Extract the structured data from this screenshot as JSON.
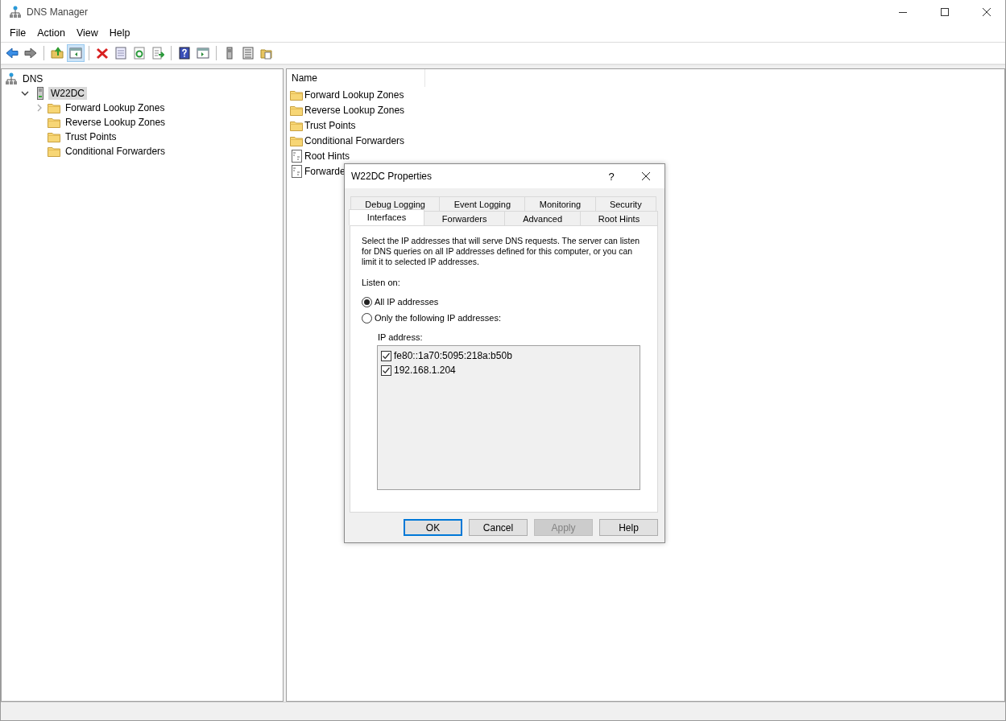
{
  "window": {
    "title": "DNS Manager"
  },
  "menu": [
    "File",
    "Action",
    "View",
    "Help"
  ],
  "toolbar": [
    {
      "kind": "back",
      "pressed": false
    },
    {
      "kind": "forward",
      "pressed": false
    },
    {
      "kind": "separator"
    },
    {
      "kind": "up",
      "pressed": false
    },
    {
      "kind": "tree",
      "pressed": true
    },
    {
      "kind": "separator"
    },
    {
      "kind": "delete",
      "pressed": false
    },
    {
      "kind": "properties",
      "pressed": false
    },
    {
      "kind": "refresh",
      "pressed": false
    },
    {
      "kind": "export",
      "pressed": false
    },
    {
      "kind": "separator"
    },
    {
      "kind": "help",
      "pressed": false
    },
    {
      "kind": "pane",
      "pressed": false
    },
    {
      "kind": "separator"
    },
    {
      "kind": "server",
      "pressed": false
    },
    {
      "kind": "list",
      "pressed": false
    },
    {
      "kind": "folder-doc",
      "pressed": false
    }
  ],
  "tree": [
    {
      "label": "DNS",
      "kind": "dns",
      "selected": false,
      "children": [
        {
          "label": "W22DC",
          "kind": "server",
          "selected": true,
          "expanded": true,
          "children": [
            {
              "label": "Forward Lookup Zones",
              "kind": "folder",
              "selected": false,
              "expanded": false
            },
            {
              "label": "Reverse Lookup Zones",
              "kind": "folder",
              "selected": false
            },
            {
              "label": "Trust Points",
              "kind": "folder",
              "selected": false
            },
            {
              "label": "Conditional Forwarders",
              "kind": "folder",
              "selected": false
            }
          ]
        }
      ]
    }
  ],
  "list": {
    "columns": [
      "Name"
    ],
    "items": [
      {
        "name": "Forward Lookup Zones",
        "kind": "folder"
      },
      {
        "name": "Reverse Lookup Zones",
        "kind": "folder"
      },
      {
        "name": "Trust Points",
        "kind": "folder"
      },
      {
        "name": "Conditional Forwarders",
        "kind": "folder"
      },
      {
        "name": "Root Hints",
        "kind": "file"
      },
      {
        "name": "Forwarde",
        "kind": "file"
      }
    ]
  },
  "dialog": {
    "title": "W22DC Properties",
    "help": "?",
    "tab_rows": [
      [
        {
          "label": "Debug Logging",
          "selected": false
        },
        {
          "label": "Event Logging",
          "selected": false
        },
        {
          "label": "Monitoring",
          "selected": false
        },
        {
          "label": "Security",
          "selected": false
        }
      ],
      [
        {
          "label": "Interfaces",
          "selected": true
        },
        {
          "label": "Forwarders",
          "selected": false
        },
        {
          "label": "Advanced",
          "selected": false
        },
        {
          "label": "Root Hints",
          "selected": false
        }
      ]
    ],
    "description": "Select the IP addresses that will serve DNS requests. The server can listen for DNS queries on all IP addresses defined for this computer, or you can limit it to selected IP addresses.",
    "listen_label": "Listen on:",
    "radios": [
      {
        "label": "All IP addresses",
        "selected": true
      },
      {
        "label": "Only the following IP addresses:",
        "selected": false
      }
    ],
    "ip_label": "IP address:",
    "addresses": [
      {
        "label": "fe80::1a70:5095:218a:b50b",
        "checked": true
      },
      {
        "label": "192.168.1.204",
        "checked": true
      }
    ],
    "buttons": [
      {
        "label": "OK",
        "default": true,
        "disabled": false
      },
      {
        "label": "Cancel",
        "default": false,
        "disabled": false
      },
      {
        "label": "Apply",
        "default": false,
        "disabled": true
      },
      {
        "label": "Help",
        "default": false,
        "disabled": false
      }
    ]
  }
}
